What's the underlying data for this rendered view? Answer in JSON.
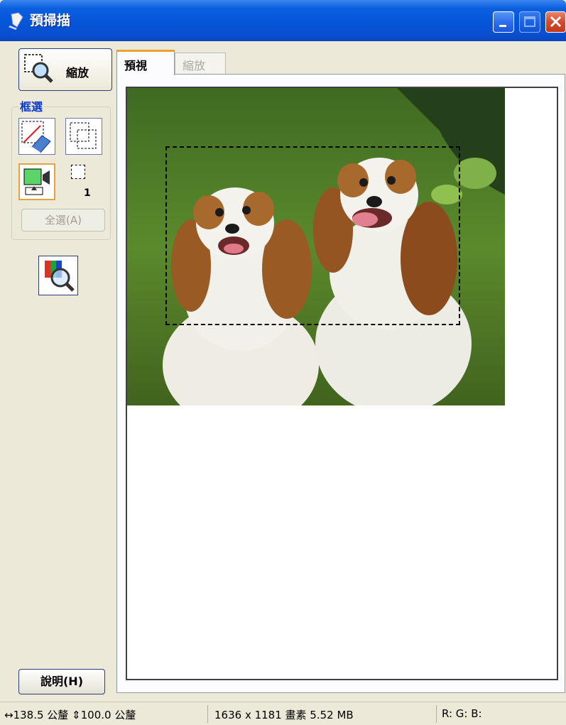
{
  "window": {
    "title": "預掃描"
  },
  "left_panel": {
    "zoom_button_label": "縮放",
    "marquee_group_label": "框選",
    "marquee_count": "1",
    "select_all_label": "全選(A)",
    "help_button_label": "說明(H)"
  },
  "tabs": [
    {
      "label": "預視",
      "active": true
    },
    {
      "label": "縮放",
      "active": false
    }
  ],
  "status_bar": {
    "dimensions": "↔138.5 公釐 ⇕100.0 公釐",
    "pixels_size": "1636 x 1181 畫素 5.52 MB",
    "rgb": "R: G: B:"
  },
  "colors": {
    "titlebar": "#0555d8",
    "accent_tab": "#f0a030",
    "group_label": "#0a3acc"
  }
}
